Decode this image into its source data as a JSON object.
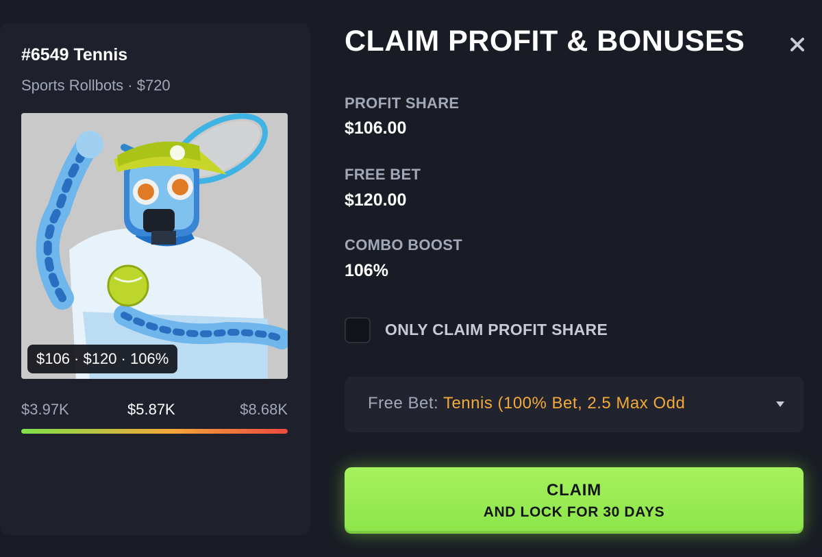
{
  "nft": {
    "title": "#6549 Tennis",
    "subtitle": "Sports Rollbots · $720",
    "badge": "$106 · $120 · 106%",
    "image_icon": "tennis-robot-image",
    "range": {
      "low": "$3.97K",
      "mid": "$5.87K",
      "high": "$8.68K",
      "gradient_colors": [
        "#7ee04a",
        "#f2a93a",
        "#ee4a3f"
      ]
    }
  },
  "panel": {
    "title": "CLAIM PROFIT & BONUSES",
    "close_icon": "close-icon",
    "stats": [
      {
        "label": "PROFIT SHARE",
        "value": "$106.00"
      },
      {
        "label": "FREE BET",
        "value": "$120.00"
      },
      {
        "label": "COMBO BOOST",
        "value": "106%"
      }
    ],
    "only_claim": {
      "label": "ONLY CLAIM PROFIT SHARE",
      "checked": false
    },
    "free_bet_select": {
      "prefix": "Free Bet:",
      "value": "Tennis (100% Bet, 2.5 Max Odd",
      "caret_icon": "caret-down-icon"
    },
    "claim_button": {
      "line1": "CLAIM",
      "line2": "AND LOCK FOR 30 DAYS"
    }
  },
  "colors": {
    "background": "#191c24",
    "card": "#1e212b",
    "accent_green": "#9ced55",
    "accent_orange": "#f2a93a",
    "muted_text": "#a3a8b8"
  }
}
